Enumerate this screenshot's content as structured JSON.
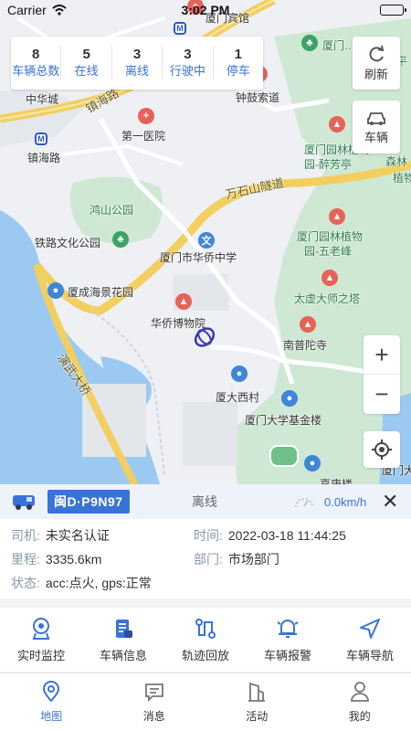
{
  "status_bar": {
    "carrier": "Carrier",
    "time": "3:02 PM"
  },
  "stats": [
    {
      "count": "8",
      "label": "车辆总数"
    },
    {
      "count": "5",
      "label": "在线"
    },
    {
      "count": "3",
      "label": "离线"
    },
    {
      "count": "3",
      "label": "行驶中"
    },
    {
      "count": "1",
      "label": "停车"
    }
  ],
  "map_buttons": {
    "refresh": "刷新",
    "vehicle": "车辆",
    "zoom_in": "+",
    "zoom_out": "−"
  },
  "map_labels": {
    "hotel": "厦门宾馆",
    "zhujiang": "厦门… -竹奖",
    "ping": "平",
    "zhonghuacheng": "中华城",
    "zhenhailu1": "镇海路",
    "zhenhailu2": "镇海路",
    "zhonggu": "钟鼓索道",
    "hospital": "第一医院",
    "garden1": "厦门园林植物",
    "garden1b": "园-醉芳亭",
    "senlin": "森林",
    "zhiwu": "植物",
    "tunnel": "万石山隧道",
    "hongshan": "鸿山公园",
    "tielu": "铁路文化公园",
    "huaqiao": "厦门市华侨中学",
    "garden2": "厦门园林植物",
    "garden2b": "园-五老峰",
    "chenghai": "厦成海景花园",
    "museum": "华侨博物院",
    "taixu": "太虚大师之塔",
    "yanwu": "演武大桥",
    "putuo": "南普陀寺",
    "xiada": "厦大西村",
    "foundation": "厦门大学基金楼",
    "xiamen_u": "厦门大学",
    "xuesheng": "嘉庚楼"
  },
  "vehicle": {
    "plate": "闽D·P9N97",
    "status": "离线",
    "speed": "0.0km/h",
    "driver_label": "司机:",
    "driver": "未实名认证",
    "time_label": "时间:",
    "time": "2022-03-18 11:44:25",
    "mileage_label": "里程:",
    "mileage": "3335.6km",
    "dept_label": "部门:",
    "dept": "市场部门",
    "state_label": "状态:",
    "state": "acc:点火, gps:正常"
  },
  "actions": [
    {
      "label": "实时监控",
      "icon": "camera-icon"
    },
    {
      "label": "车辆信息",
      "icon": "document-icon"
    },
    {
      "label": "轨迹回放",
      "icon": "route-icon"
    },
    {
      "label": "车辆报警",
      "icon": "bell-icon"
    },
    {
      "label": "车辆导航",
      "icon": "navigation-icon"
    }
  ],
  "tabs": [
    {
      "label": "地图",
      "icon": "map-pin-icon",
      "active": true
    },
    {
      "label": "消息",
      "icon": "message-icon",
      "active": false
    },
    {
      "label": "活动",
      "icon": "building-icon",
      "active": false
    },
    {
      "label": "我的",
      "icon": "user-icon",
      "active": false
    }
  ],
  "colors": {
    "accent": "#3a73d8",
    "active_tab": "#3a73d8",
    "road": "#f2cf5f",
    "park": "#cfe8d3",
    "water": "#9cc9f2"
  }
}
